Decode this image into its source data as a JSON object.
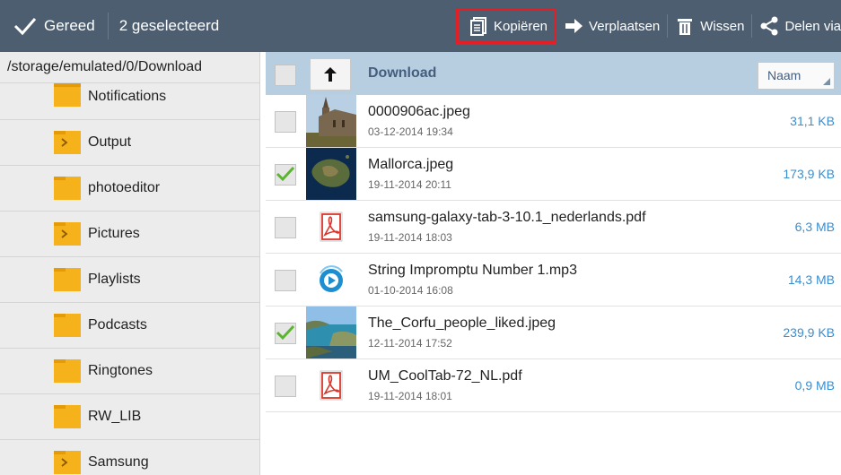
{
  "actionbar": {
    "done_label": "Gereed",
    "selected_label": "2 geselecteerd",
    "copy_label": "Kopiëren",
    "move_label": "Verplaatsen",
    "delete_label": "Wissen",
    "share_label": "Delen via",
    "accent_color": "#e21f26"
  },
  "sidebar": {
    "path": "/storage/emulated/0/Download",
    "folders": [
      {
        "name": "Notifications",
        "icon": "folder-icon"
      },
      {
        "name": "Output",
        "icon": "folder-arrow-icon"
      },
      {
        "name": "photoeditor",
        "icon": "folder-icon"
      },
      {
        "name": "Pictures",
        "icon": "folder-arrow-icon"
      },
      {
        "name": "Playlists",
        "icon": "folder-icon"
      },
      {
        "name": "Podcasts",
        "icon": "folder-icon"
      },
      {
        "name": "Ringtones",
        "icon": "folder-icon"
      },
      {
        "name": "RW_LIB",
        "icon": "folder-icon"
      },
      {
        "name": "Samsung",
        "icon": "folder-arrow-icon"
      }
    ]
  },
  "filelist": {
    "title": "Download",
    "sort_label": "Naam",
    "files": [
      {
        "name": "0000906ac.jpeg",
        "date": "03-12-2014 19:34",
        "size": "31,1 KB",
        "checked": false,
        "thumb": "church-photo"
      },
      {
        "name": "Mallorca.jpeg",
        "date": "19-11-2014 20:11",
        "size": "173,9 KB",
        "checked": true,
        "thumb": "satellite-photo"
      },
      {
        "name": "samsung-galaxy-tab-3-10.1_nederlands.pdf",
        "date": "19-11-2014 18:03",
        "size": "6,3 MB",
        "checked": false,
        "thumb": "pdf-icon"
      },
      {
        "name": "String Impromptu Number 1.mp3",
        "date": "01-10-2014 16:08",
        "size": "14,3 MB",
        "checked": false,
        "thumb": "music-icon"
      },
      {
        "name": "The_Corfu_people_liked.jpeg",
        "date": "12-11-2014 17:52",
        "size": "239,9 KB",
        "checked": true,
        "thumb": "coast-photo"
      },
      {
        "name": "UM_CoolTab-72_NL.pdf",
        "date": "19-11-2014 18:01",
        "size": "0,9 MB",
        "checked": false,
        "thumb": "pdf-icon"
      }
    ]
  }
}
